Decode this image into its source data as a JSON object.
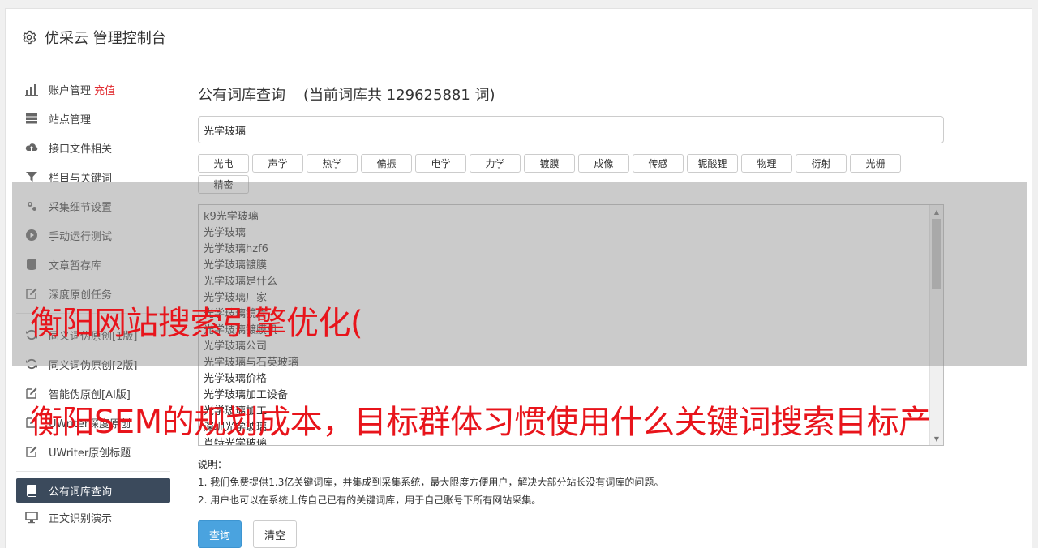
{
  "header": {
    "title": "优采云 管理控制台",
    "icon": "gear-icon"
  },
  "sidebar": {
    "items": [
      {
        "label": "账户管理",
        "extra": "充值",
        "icon": "bar-chart-icon"
      },
      {
        "label": "站点管理",
        "icon": "server-icon"
      },
      {
        "label": "接口文件相关",
        "icon": "cloud-upload-icon"
      },
      {
        "label": "栏目与关键词",
        "icon": "filter-icon"
      },
      {
        "label": "采集细节设置",
        "icon": "gears-icon"
      },
      {
        "label": "手动运行测试",
        "icon": "play-circle-icon"
      },
      {
        "label": "文章暂存库",
        "icon": "database-icon"
      },
      {
        "label": "深度原创任务",
        "icon": "edit-icon"
      },
      {
        "label": "同义词伪原创[1版]",
        "icon": "refresh-icon"
      },
      {
        "label": "同义词伪原创[2版]",
        "icon": "refresh-icon"
      },
      {
        "label": "智能伪原创[AI版]",
        "icon": "edit-icon"
      },
      {
        "label": "UWriter深度原创",
        "icon": "edit-icon"
      },
      {
        "label": "UWriter原创标题",
        "icon": "edit-icon"
      },
      {
        "label": "公有词库查询",
        "icon": "book-icon",
        "active": true
      },
      {
        "label": "正文识别演示",
        "icon": "monitor-icon"
      }
    ]
  },
  "main": {
    "title": "公有词库查询",
    "count_text": "(当前词库共 129625881 词)",
    "search_value": "光学玻璃",
    "tags": [
      "光电",
      "声学",
      "热学",
      "偏振",
      "电学",
      "力学",
      "镀膜",
      "成像",
      "传感",
      "铌酸锂",
      "物理",
      "衍射",
      "光栅",
      "精密"
    ],
    "results": [
      "k9光学玻璃",
      "光学玻璃",
      "光学玻璃hzf6",
      "光学玻璃镀膜",
      "光学玻璃是什么",
      "光学玻璃厂家",
      "光学玻璃镜片",
      "光学玻璃镀膜机",
      "光学玻璃公司",
      "光学玻璃与石英玻璃",
      "光学玻璃价格",
      "光学玻璃加工设备",
      "光学玻璃加工",
      "深圳光学玻璃",
      "肖特光学玻璃"
    ],
    "notes_title": "说明：",
    "notes": [
      "1. 我们免费提供1.3亿关键词库，并集成到采集系统，最大限度方便用户，解决大部分站长没有词库的问题。",
      "2. 用户也可以在系统上传自己已有的关键词库，用于自己账号下所有网站采集。"
    ],
    "query_button": "查询",
    "clear_button": "清空"
  },
  "overlay": {
    "line1": "衡阳网站搜索引擎优化(",
    "line2": "衡阳SEM的规划成本，目标群体习惯使用什么关键词搜索目标产"
  },
  "colors": {
    "active_nav": "#3b4a5c",
    "primary": "#4aa3df",
    "overlay_text": "#e8141b",
    "red_link": "#e0292e"
  }
}
